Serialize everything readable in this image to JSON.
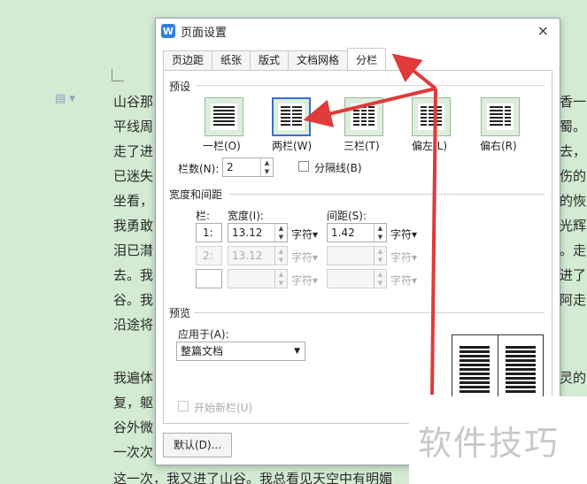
{
  "document": {
    "left_lines": [
      "山谷那",
      "平线周",
      "走了进",
      "已迷失",
      "坐看，",
      "我勇敢",
      "泪已潸",
      "去。我",
      "谷。我",
      "沿途将",
      "",
      "我遍体",
      "复，躯",
      "谷外微",
      "一次次",
      "这一次，我又进了山谷。我总看见天空中有明媚"
    ],
    "right_lines": [
      "香一カ",
      "蜀。ま",
      "去，ま",
      "伤的",
      "的恢复",
      "光辉吋",
      "。走",
      "进了",
      "阿走",
      "",
      "灵的",
      "",
      ""
    ]
  },
  "dialog": {
    "title": "页面设置",
    "close": "×",
    "tabs": [
      {
        "label": "页边距",
        "active": false
      },
      {
        "label": "纸张",
        "active": false
      },
      {
        "label": "版式",
        "active": false
      },
      {
        "label": "文档网格",
        "active": false
      },
      {
        "label": "分栏",
        "active": true
      }
    ],
    "presets": {
      "section": "预设",
      "items": [
        {
          "label": "一栏(O)",
          "columns": 1
        },
        {
          "label": "两栏(W)",
          "columns": 2
        },
        {
          "label": "三栏(T)",
          "columns": 3
        },
        {
          "label": "偏左(L)",
          "columns": 2
        },
        {
          "label": "偏右(R)",
          "columns": 2
        }
      ],
      "selected_index": 1
    },
    "columns_count": {
      "label": "栏数(N):",
      "value": "2"
    },
    "divider": {
      "label": "分隔线(B)",
      "checked": false
    },
    "width_spacing": {
      "section": "宽度和间距",
      "col_header": "栏:",
      "width_header": "宽度(I):",
      "spacing_header": "间距(S):",
      "unit": "字符▾",
      "rows": [
        {
          "num": "1:",
          "width": "13.12",
          "spacing": "1.42",
          "enabled": true
        },
        {
          "num": "2:",
          "width": "13.12",
          "spacing": "",
          "enabled": false
        },
        {
          "num": "",
          "width": "",
          "spacing": "",
          "enabled": false
        }
      ]
    },
    "preview": {
      "section": "预览",
      "apply_label": "应用于(A):",
      "apply_value": "整篇文档"
    },
    "new_column": {
      "label": "开始新栏(U)",
      "checked": false,
      "enabled": false
    },
    "default_button": "默认(D)..."
  },
  "watermark": "软件技巧",
  "colors": {
    "annotation_arrow": "#e03a3a",
    "selection": "#3b6ecf",
    "doc_bg": "#d3ebd3"
  }
}
